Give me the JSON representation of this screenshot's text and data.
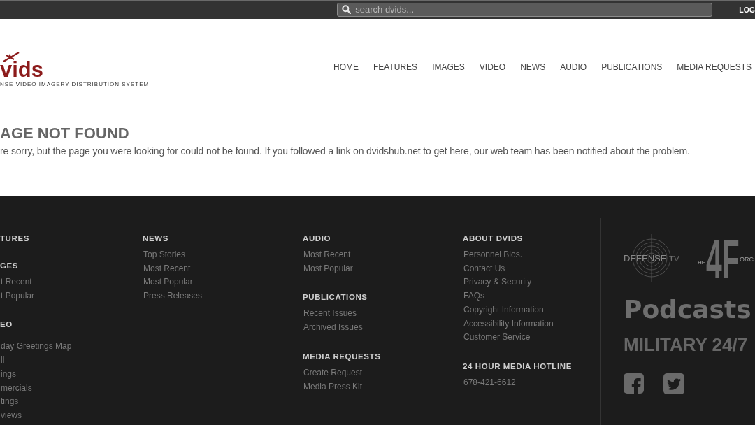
{
  "top_bar": {
    "search": {
      "placeholder": "search dvids..."
    },
    "account_link": "LOG"
  },
  "header": {
    "logo": {
      "wordmark": "vids",
      "tagline": "NSE VIDEO IMAGERY DISTRIBUTION SYSTEM"
    },
    "nav": [
      "HOME",
      "FEATURES",
      "IMAGES",
      "VIDEO",
      "NEWS",
      "AUDIO",
      "PUBLICATIONS",
      "MEDIA REQUESTS"
    ]
  },
  "error": {
    "title": "AGE NOT FOUND",
    "message": "re sorry, but the page you were looking for could not be found. If you followed a link on dvidshub.net to get here, our web team has been notified about the problem."
  },
  "footer": {
    "columns": [
      [
        {
          "heading": "TURES"
        },
        {
          "heading": "GES",
          "links": [
            "t Recent",
            "t Popular"
          ]
        },
        {
          "heading": "EO",
          "links": [
            "day Greetings Map",
            "ll",
            "ings",
            "mercials",
            "tings",
            "views"
          ]
        }
      ],
      [
        {
          "heading": "NEWS",
          "links": [
            "Top Stories",
            "Most Recent",
            "Most Popular",
            "Press Releases"
          ]
        }
      ],
      [
        {
          "heading": "AUDIO",
          "links": [
            "Most Recent",
            "Most Popular"
          ]
        },
        {
          "heading": "PUBLICATIONS",
          "links": [
            "Recent Issues",
            "Archived Issues"
          ]
        },
        {
          "heading": "MEDIA REQUESTS",
          "links": [
            "Create Request",
            "Media Press Kit"
          ]
        }
      ],
      [
        {
          "heading": "ABOUT DVIDS",
          "links": [
            "Personnel Bios.",
            "Contact Us",
            "Privacy & Security",
            "FAQs",
            "Copyright Information",
            "Accessibility Information",
            "Customer Service"
          ]
        },
        {
          "heading": "24 HOUR MEDIA HOTLINE",
          "links": [
            "678-421-6612"
          ]
        }
      ]
    ],
    "promos": {
      "logos": [
        {
          "kind": "target",
          "title": "DEFENSE",
          "suffix": "TV"
        },
        {
          "kind": "big_mark",
          "mark": "4F",
          "prefix": "THE",
          "suffix": "ORC"
        }
      ],
      "podcasts": "Podcasts",
      "tagline": "MILITARY 24/7",
      "social": [
        {
          "kind": "facebook"
        },
        {
          "kind": "twitter"
        }
      ]
    }
  }
}
